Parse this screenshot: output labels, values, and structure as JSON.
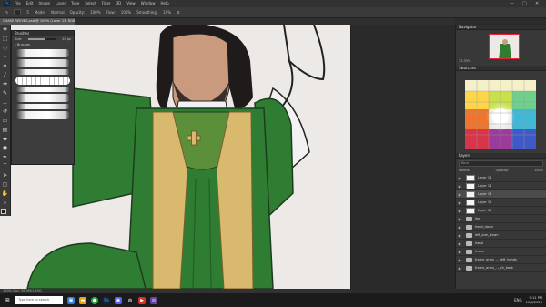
{
  "menubar": {
    "app_badge": "Ps",
    "items": [
      "File",
      "Edit",
      "Image",
      "Layer",
      "Type",
      "Select",
      "Filter",
      "3D",
      "View",
      "Window",
      "Help"
    ],
    "minimize": "—",
    "maximize": "▢",
    "close": "✕"
  },
  "options": {
    "brush_size": "5",
    "mode_label": "Mode:",
    "mode_value": "Normal",
    "opacity_label": "Opacity:",
    "opacity_value": "100%",
    "flow_label": "Flow:",
    "flow_value": "100%",
    "smoothing_label": "Smoothing:",
    "smoothing_value": "10%"
  },
  "document": {
    "tab_title": "CHASE REEVES.psd @ 100% (Layer 13, RGB/8)",
    "status_text": "100%   Doc: 38.5M/1.45G"
  },
  "brushes_panel": {
    "title": "Brushes",
    "size_label": "Size:",
    "size_value": "20 px",
    "folder_label": "Brushes"
  },
  "right_panels": {
    "navigator_title": "Navigator",
    "zoom_value": "33.33%",
    "swatches_title": "Swatches",
    "layers_title": "Layers",
    "filter_kind": "Kind",
    "blend_mode": "Normal",
    "opacity_label": "Opacity:",
    "opacity_value": "100%",
    "layers": [
      {
        "name": "Layer 15",
        "type": "layer"
      },
      {
        "name": "Layer 14",
        "type": "layer"
      },
      {
        "name": "Layer 13",
        "type": "layer",
        "selected": true
      },
      {
        "name": "Layer 12",
        "type": "layer"
      },
      {
        "name": "Layer 11",
        "type": "layer"
      },
      {
        "name": "line",
        "type": "folder"
      },
      {
        "name": "head_down",
        "type": "folder"
      },
      {
        "name": "left_arm_down",
        "type": "folder"
      },
      {
        "name": "hand",
        "type": "folder"
      },
      {
        "name": "frame",
        "type": "folder"
      },
      {
        "name": "frame_arms_..._left_hands",
        "type": "folder"
      },
      {
        "name": "frame_arms_..._ch_back",
        "type": "folder"
      }
    ]
  },
  "taskbar": {
    "search_placeholder": "Type here to search",
    "time": "9:11 PM",
    "date": "10/3/2020",
    "lang": "ENG"
  },
  "colors": {
    "robe_green": "#2f7d32",
    "stole_tan": "#d9b96e",
    "photoshop_blue": "#31a8ff",
    "canvas_bg": "#ece9e6"
  }
}
